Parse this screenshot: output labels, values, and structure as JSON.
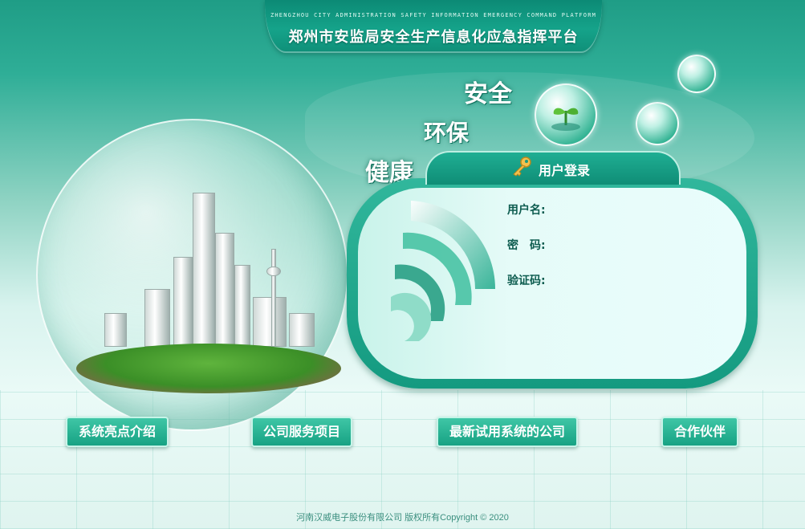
{
  "header": {
    "subtitle_en": "ZHENGZHOU CITY ADMINISTRATION SAFETY INFORMATION EMERGENCY COMMAND PLATFORM",
    "title": "郑州市安监局安全生产信息化应急指挥平台"
  },
  "slogans": {
    "safety": "安全",
    "environment": "环保",
    "health": "健康"
  },
  "login": {
    "title": "用户登录",
    "username_label": "用户名:",
    "password_label": "密　码:",
    "captcha_label": "验证码:",
    "username_value": "",
    "password_value": "",
    "captcha_value": ""
  },
  "nav": {
    "highlights": "系统亮点介绍",
    "services": "公司服务项目",
    "trial_companies": "最新试用系统的公司",
    "partners": "合作伙伴"
  },
  "footer": {
    "copyright": "河南汉威电子股份有限公司  版权所有Copyright © 2020"
  },
  "colors": {
    "primary": "#149a80",
    "accent": "#1fae93",
    "label_text": "#0d5c4f",
    "panel_bg": "#e6fbf8"
  }
}
